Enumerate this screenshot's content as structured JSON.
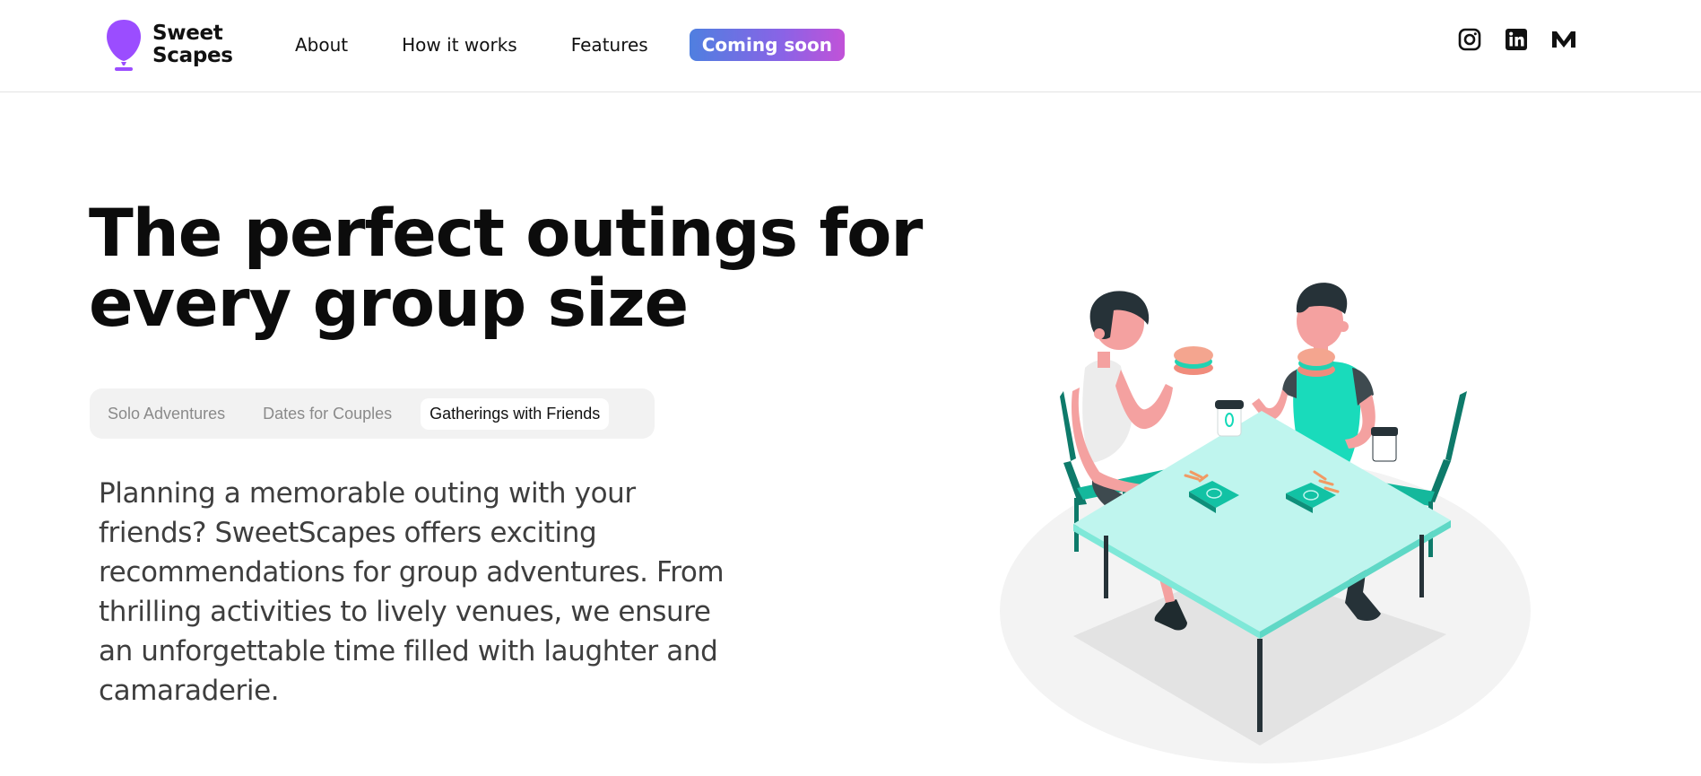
{
  "header": {
    "logo": {
      "line1": "Sweet",
      "line2": "Scapes",
      "icon": "balloon-icon",
      "color": "#9b4dff"
    },
    "nav": [
      {
        "label": "About"
      },
      {
        "label": "How it works"
      },
      {
        "label": "Features"
      }
    ],
    "cta": {
      "label": "Coming soon",
      "gradient": [
        "#4f7fe0",
        "#8a63e6",
        "#c152d8"
      ]
    },
    "socials": [
      {
        "icon": "instagram-icon"
      },
      {
        "icon": "linkedin-icon"
      },
      {
        "icon": "medium-icon"
      }
    ]
  },
  "hero": {
    "title_line1": "The perfect outings for",
    "title_line2": "every group size",
    "tabs": [
      {
        "label": "Solo Adventures",
        "active": false
      },
      {
        "label": "Dates for Couples",
        "active": false
      },
      {
        "label": "Gatherings with Friends",
        "active": true
      }
    ],
    "description": "Planning a memorable outing with your friends? SweetScapes offers exciting recommendations for group adventures. From thrilling activities to lively venues, we ensure an unforgettable time filled with laughter and camaraderie.",
    "illustration": "friends-eating-at-table-illustration"
  },
  "colors": {
    "accent_teal": "#12d9b8",
    "table_top": "#bff5ee",
    "dark_teal": "#0e7a6a"
  }
}
